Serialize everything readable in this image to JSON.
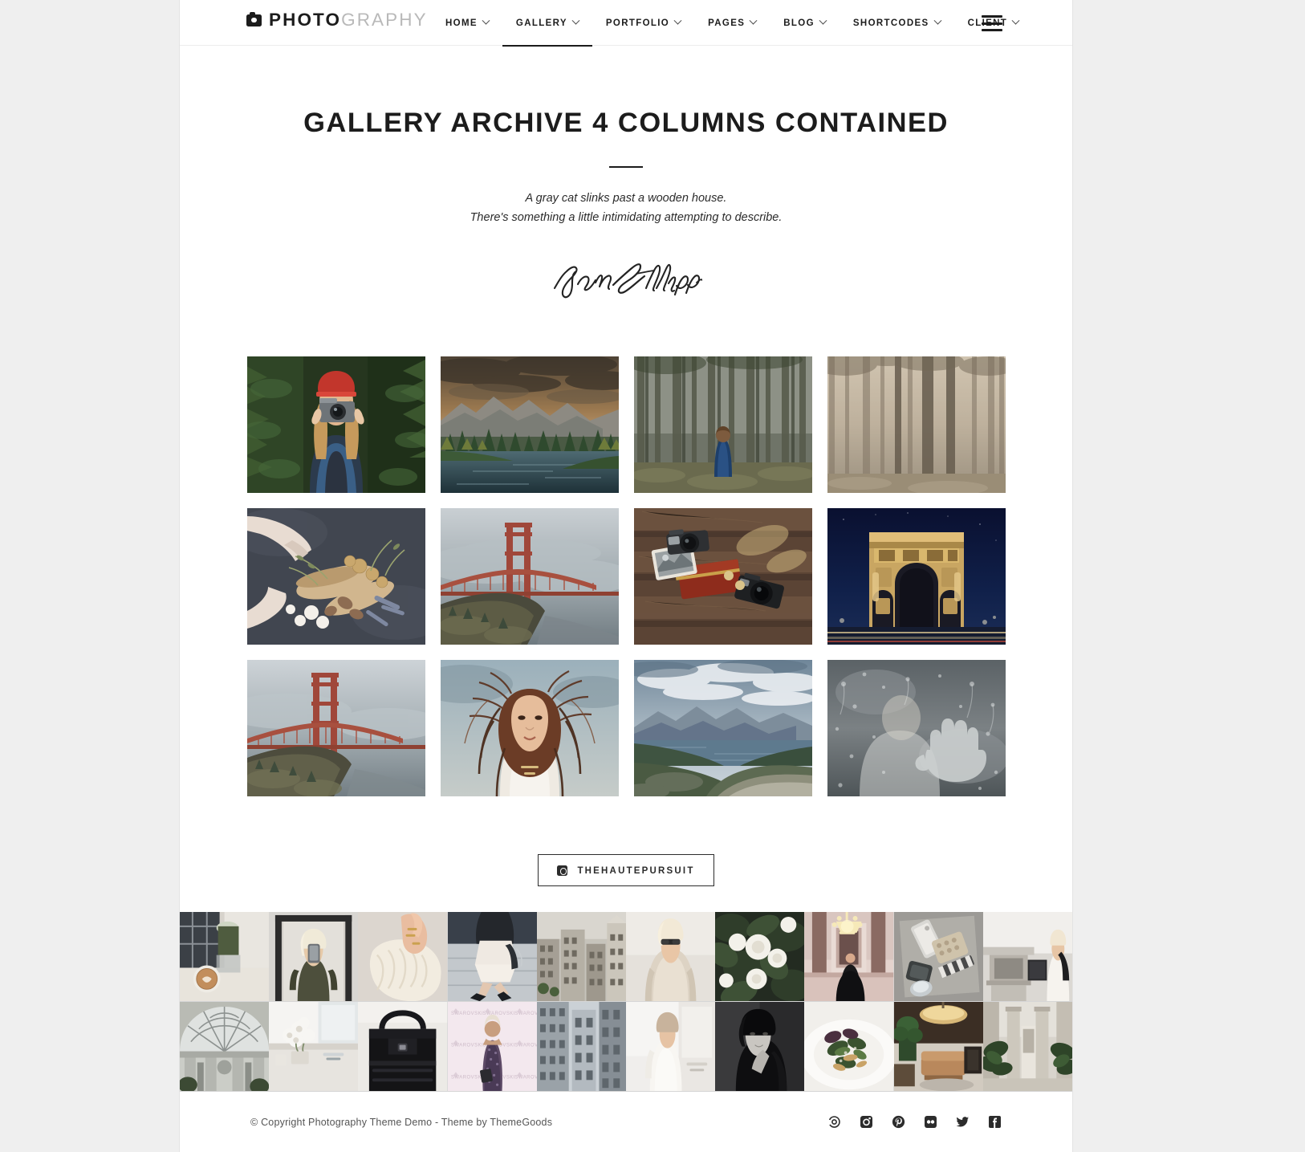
{
  "site": {
    "background": "#efefef",
    "container_bg": "#ffffff",
    "accent": "#1c1c1c"
  },
  "header": {
    "logo": {
      "bold": "PHOTO",
      "light": "GRAPHY",
      "icon": "camera-icon"
    },
    "menu": [
      {
        "label": "HOME",
        "has_caret": true,
        "active": false
      },
      {
        "label": "GALLERY",
        "has_caret": true,
        "active": true
      },
      {
        "label": "PORTFOLIO",
        "has_caret": true,
        "active": false
      },
      {
        "label": "PAGES",
        "has_caret": true,
        "active": false
      },
      {
        "label": "BLOG",
        "has_caret": true,
        "active": false
      },
      {
        "label": "SHORTCODES",
        "has_caret": true,
        "active": false
      },
      {
        "label": "CLIENT",
        "has_caret": true,
        "active": false
      }
    ],
    "hamburger_icon": "hamburger-menu-icon"
  },
  "main": {
    "title": "GALLERY ARCHIVE 4 COLUMNS CONTAINED",
    "subtitle_line1": "A gray cat slinks past a wooden house.",
    "subtitle_line2": "There's something a little intimidating attempting to describe.",
    "signature": "John Phillips"
  },
  "gallery": {
    "columns": 4,
    "items": [
      {
        "name": "woman-photographer-red-beanie-forest"
      },
      {
        "name": "mountain-lake-sunset-pine-forest"
      },
      {
        "name": "person-blue-coat-standing-in-woods"
      },
      {
        "name": "foggy-pine-forest-sepia"
      },
      {
        "name": "hands-arranging-dried-flowers-flatlay"
      },
      {
        "name": "golden-gate-bridge-in-fog"
      },
      {
        "name": "vintage-cameras-and-photos-on-wood"
      },
      {
        "name": "arc-de-triomphe-at-night"
      },
      {
        "name": "golden-gate-bridge-coastal-hill"
      },
      {
        "name": "portrait-woman-windblown-hair"
      },
      {
        "name": "mountain-road-overlooking-lake"
      },
      {
        "name": "hand-on-rainy-window-glass"
      }
    ]
  },
  "instagram": {
    "button_label": "THEHAUTEPURSUIT",
    "button_icon": "instagram-icon",
    "feed_columns": 10,
    "feed_rows": 2,
    "feed_items": [
      {
        "name": "latte-art-marble-table-window"
      },
      {
        "name": "mirror-selfie-blonde-bob-phone"
      },
      {
        "name": "hand-rings-cream-knit-sweater"
      },
      {
        "name": "street-style-white-dress-leather-jacket"
      },
      {
        "name": "city-rooftop-architecture-daylight"
      },
      {
        "name": "beige-trench-coat-sunglasses"
      },
      {
        "name": "white-roses-green-foliage"
      },
      {
        "name": "black-gown-chandelier-ballroom"
      },
      {
        "name": "flatlay-phone-handbag-accessories"
      },
      {
        "name": "woman-white-dress-on-stairs-interior"
      },
      {
        "name": "glass-dome-atrium-architecture"
      },
      {
        "name": "white-flowers-bright-bathroom-vanity"
      },
      {
        "name": "black-leather-handbag-closeup"
      },
      {
        "name": "red-carpet-sequin-gown-swarovski"
      },
      {
        "name": "skyscrapers-looking-up"
      },
      {
        "name": "woman-in-white-dress-mirror"
      },
      {
        "name": "black-and-white-portrait-woman"
      },
      {
        "name": "plated-salad-fine-dining"
      },
      {
        "name": "modern-lounge-interior-tan-sofa"
      },
      {
        "name": "hotel-lobby-palm-columns"
      }
    ]
  },
  "footer": {
    "copyright": "© Copyright Photography Theme Demo - Theme by ThemeGoods",
    "socials": [
      {
        "name": "500px-icon",
        "label": "500px"
      },
      {
        "name": "instagram-icon",
        "label": "Instagram"
      },
      {
        "name": "pinterest-icon",
        "label": "Pinterest"
      },
      {
        "name": "flickr-icon",
        "label": "Flickr"
      },
      {
        "name": "twitter-icon",
        "label": "Twitter"
      },
      {
        "name": "facebook-icon",
        "label": "Facebook"
      }
    ]
  }
}
